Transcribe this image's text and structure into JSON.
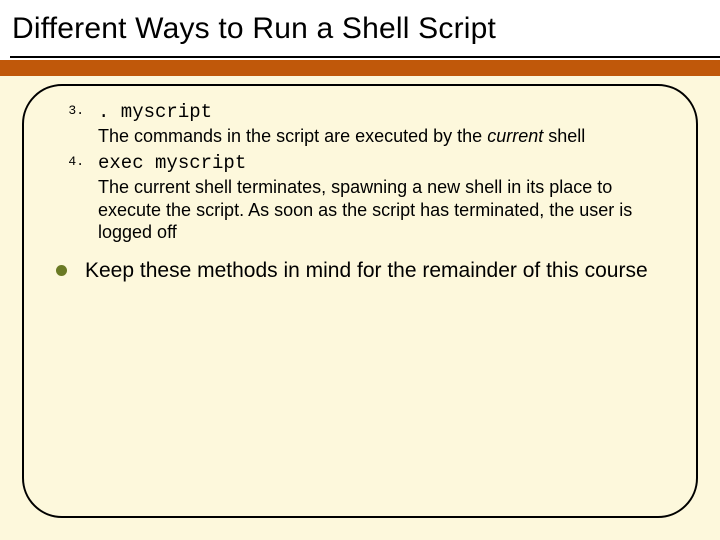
{
  "title": "Different Ways to Run a Shell Script",
  "items": [
    {
      "num": "3.",
      "cmd": ". myscript",
      "desc_pre": "The commands in the script are executed by the ",
      "desc_em": "current",
      "desc_post": " shell"
    },
    {
      "num": "4.",
      "cmd": "exec myscript",
      "desc_pre": "The current shell terminates, spawning a new shell in its place to execute the script.  As soon as the script has terminated, the user is logged off",
      "desc_em": "",
      "desc_post": ""
    }
  ],
  "bullet": "Keep these methods in mind for the remainder of this course"
}
